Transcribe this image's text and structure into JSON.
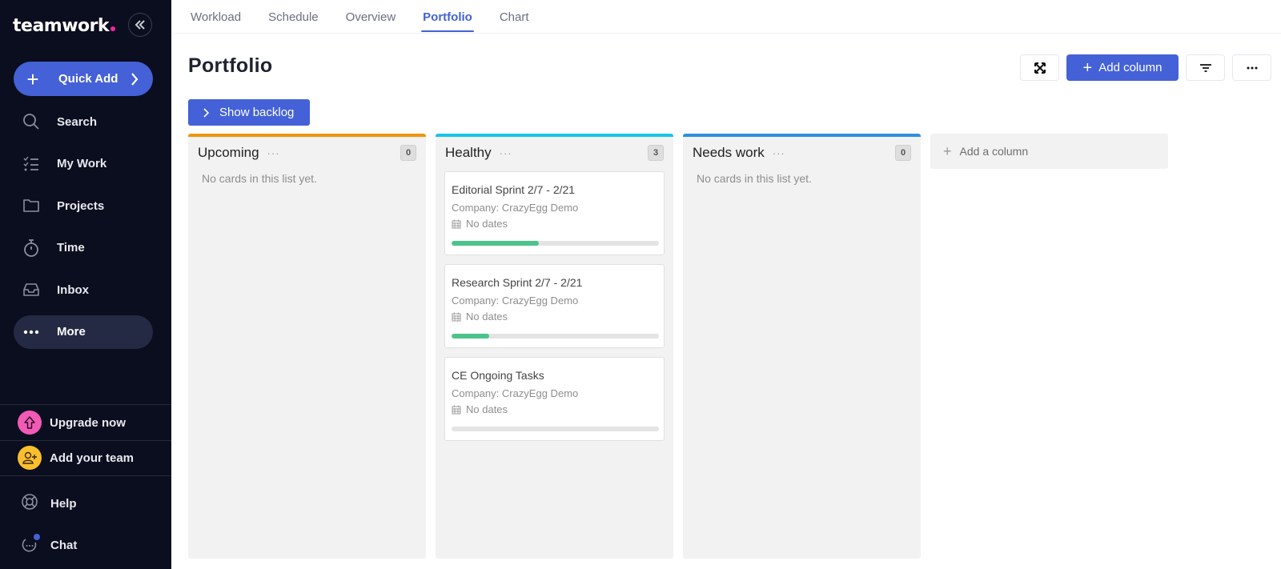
{
  "sidebar": {
    "logo": "teamwork",
    "quick_add": "Quick Add",
    "nav": [
      {
        "label": "Search",
        "icon": "search-icon"
      },
      {
        "label": "My Work",
        "icon": "checklist-icon"
      },
      {
        "label": "Projects",
        "icon": "folder-icon"
      },
      {
        "label": "Time",
        "icon": "stopwatch-icon"
      },
      {
        "label": "Inbox",
        "icon": "inbox-icon"
      },
      {
        "label": "More",
        "icon": "more-dots-icon",
        "active": true
      }
    ],
    "upgrade": "Upgrade now",
    "add_team": "Add your team",
    "help": "Help",
    "chat": "Chat"
  },
  "tabs": [
    {
      "label": "Workload"
    },
    {
      "label": "Schedule"
    },
    {
      "label": "Overview"
    },
    {
      "label": "Portfolio",
      "active": true
    },
    {
      "label": "Chart"
    }
  ],
  "page": {
    "title": "Portfolio",
    "add_column": "Add column",
    "show_backlog": "Show backlog"
  },
  "board": {
    "columns": [
      {
        "title": "Upcoming",
        "count": "0",
        "color": "#f0950c",
        "empty": "No cards in this list yet.",
        "cards": []
      },
      {
        "title": "Healthy",
        "count": "3",
        "color": "#14c6ea",
        "empty": "",
        "cards": [
          {
            "title": "Editorial Sprint 2/7 - 2/21",
            "company": "Company: CrazyEgg Demo",
            "dates": "No dates",
            "progress": 42
          },
          {
            "title": "Research Sprint 2/7 - 2/21",
            "company": "Company: CrazyEgg Demo",
            "dates": "No dates",
            "progress": 18
          },
          {
            "title": "CE Ongoing Tasks",
            "company": "Company: CrazyEgg Demo",
            "dates": "No dates",
            "progress": 0
          }
        ]
      },
      {
        "title": "Needs work",
        "count": "0",
        "color": "#2f8fde",
        "empty": "No cards in this list yet.",
        "cards": []
      }
    ],
    "add_a_column": "Add a column"
  },
  "colors": {
    "accent": "#4461d7",
    "sidebar_bg": "#0b0e1e",
    "upgrade": "#f25ab8",
    "add_team": "#fbbf2e",
    "progress": "#4cc38a"
  }
}
